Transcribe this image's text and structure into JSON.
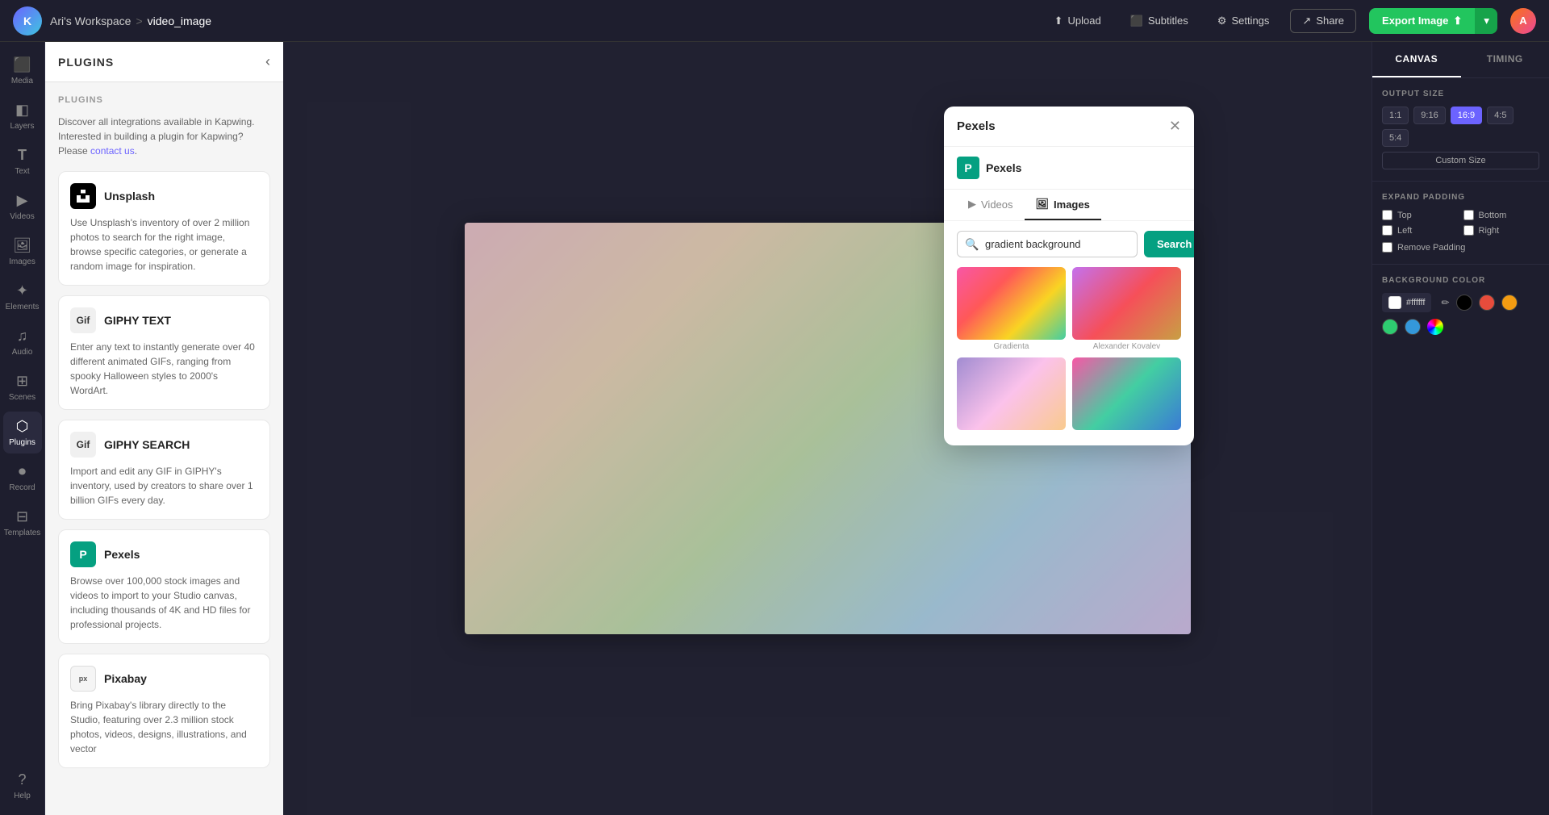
{
  "topbar": {
    "workspace": "Ari's Workspace",
    "separator": ">",
    "project": "video_image",
    "upload_label": "Upload",
    "subtitles_label": "Subtitles",
    "settings_label": "Settings",
    "share_label": "Share",
    "export_label": "Export Image"
  },
  "sidebar": {
    "items": [
      {
        "id": "media",
        "label": "Media",
        "icon": "⬛"
      },
      {
        "id": "layers",
        "label": "Layers",
        "icon": "◧"
      },
      {
        "id": "text",
        "label": "Text",
        "icon": "T"
      },
      {
        "id": "video",
        "label": "Videos",
        "icon": "▶"
      },
      {
        "id": "images",
        "label": "Images",
        "icon": "🖼"
      },
      {
        "id": "elements",
        "label": "Elements",
        "icon": "✦"
      },
      {
        "id": "audio",
        "label": "Audio",
        "icon": "♫"
      },
      {
        "id": "scenes",
        "label": "Scenes",
        "icon": "⊞"
      },
      {
        "id": "plugins",
        "label": "Plugins",
        "icon": "⬡",
        "active": true
      },
      {
        "id": "record",
        "label": "Record",
        "icon": "⏺"
      },
      {
        "id": "templates",
        "label": "Templates",
        "icon": "⊟"
      }
    ],
    "bottom_item": {
      "id": "help",
      "label": "Help",
      "icon": "?"
    }
  },
  "plugins_panel": {
    "title": "PLUGINS",
    "section_title": "PLUGINS",
    "intro": "Discover all integrations available in Kapwing. Interested in building a plugin for Kapwing? Please",
    "contact_link": "contact us",
    "plugins": [
      {
        "id": "unsplash",
        "name": "Unsplash",
        "icon": "U",
        "icon_class": "unsplash",
        "description": "Use Unsplash's inventory of over 2 million photos to search for the right image, browse specific categories, or generate a random image for inspiration."
      },
      {
        "id": "giphy-text",
        "name": "GIPHY TEXT",
        "icon": "G",
        "icon_class": "giphy-text",
        "description": "Enter any text to instantly generate over 40 different animated GIFs, ranging from spooky Halloween styles to 2000's WordArt."
      },
      {
        "id": "giphy-search",
        "name": "GIPHY SEARCH",
        "icon": "G",
        "icon_class": "giphy-search",
        "description": "Import and edit any GIF in GIPHY's inventory, used by creators to share over 1 billion GIFs every day."
      },
      {
        "id": "pexels",
        "name": "Pexels",
        "icon": "P",
        "icon_class": "pexels",
        "description": "Browse over 100,000 stock images and videos to import to your Studio canvas, including thousands of 4K and HD files for professional projects."
      },
      {
        "id": "pixabay",
        "name": "Pixabay",
        "icon": "px",
        "icon_class": "pixabay",
        "description": "Bring Pixabay's library directly to the Studio, featuring over 2.3 million stock photos, videos, designs, illustrations, and vector"
      }
    ]
  },
  "right_panel": {
    "tabs": [
      {
        "id": "canvas",
        "label": "CANVAS",
        "active": true
      },
      {
        "id": "timing",
        "label": "TIMING"
      }
    ],
    "output_size": {
      "title": "OUTPUT SIZE",
      "options": [
        {
          "label": "1:1"
        },
        {
          "label": "9:16"
        },
        {
          "label": "16:9",
          "active": true
        },
        {
          "label": "4:5"
        },
        {
          "label": "5:4"
        }
      ],
      "custom_label": "Custom Size"
    },
    "expand_padding": {
      "title": "EXPAND PADDING",
      "items": [
        {
          "label": "Top",
          "checked": false
        },
        {
          "label": "Bottom",
          "checked": false
        },
        {
          "label": "Left",
          "checked": false
        },
        {
          "label": "Right",
          "checked": false
        }
      ],
      "remove_label": "Remove Padding"
    },
    "background_color": {
      "title": "BACKGROUND COLOR",
      "hex": "#ffffff",
      "swatches": [
        "#ffffff",
        "#000000",
        "#e74c3c",
        "#f39c12",
        "#2ecc71",
        "#3498db",
        "#9b59b6"
      ]
    }
  },
  "pexels_modal": {
    "title": "Pexels",
    "brand_name": "Pexels",
    "tabs": [
      {
        "label": "Videos",
        "icon": "▶"
      },
      {
        "label": "Images",
        "icon": "🖼",
        "active": true
      }
    ],
    "search_placeholder": "gradient background",
    "search_label": "Search",
    "results": [
      {
        "label": "Gradienta",
        "gradient": "grad1"
      },
      {
        "label": "Alexander Kovalev",
        "gradient": "grad2"
      },
      {
        "label": "",
        "gradient": "grad3"
      },
      {
        "label": "",
        "gradient": "grad4"
      }
    ]
  }
}
